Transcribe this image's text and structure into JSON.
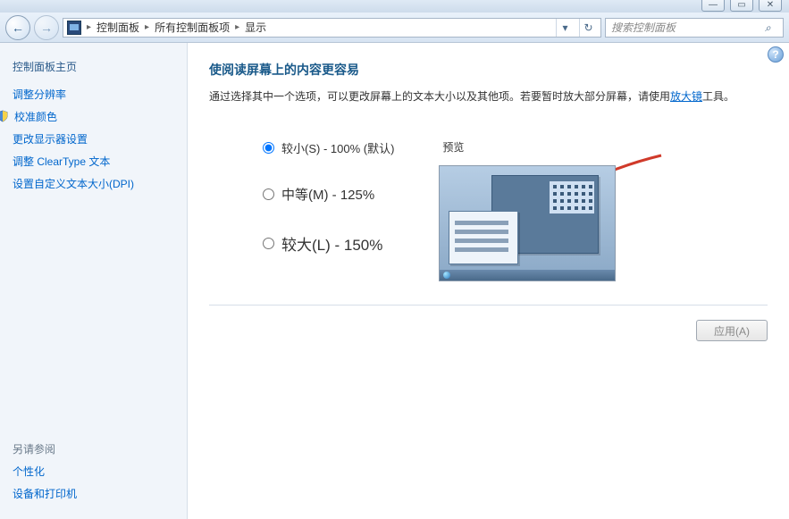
{
  "window_buttons": {
    "minimize": "—",
    "maximize": "▭",
    "close": "✕"
  },
  "nav": {
    "back_glyph": "←",
    "forward_glyph": "→",
    "dropdown_glyph": "▾",
    "refresh_glyph": "↻"
  },
  "breadcrumb": {
    "items": [
      "控制面板",
      "所有控制面板项",
      "显示"
    ],
    "sep": "▸"
  },
  "search": {
    "placeholder": "搜索控制面板",
    "icon_glyph": "⌕"
  },
  "sidebar": {
    "heading": "控制面板主页",
    "links": [
      {
        "label": "调整分辨率",
        "shield": false
      },
      {
        "label": "校准颜色",
        "shield": true
      },
      {
        "label": "更改显示器设置",
        "shield": false
      },
      {
        "label": "调整 ClearType 文本",
        "shield": false
      },
      {
        "label": "设置自定义文本大小(DPI)",
        "shield": false
      }
    ],
    "see_also_heading": "另请参阅",
    "see_also": [
      "个性化",
      "设备和打印机"
    ]
  },
  "main": {
    "help_glyph": "?",
    "title": "使阅读屏幕上的内容更容易",
    "desc_pre": "通过选择其中一个选项，可以更改屏幕上的文本大小以及其他项。若要暂时放大部分屏幕，请使用",
    "desc_link": "放大镜",
    "desc_post": "工具。",
    "options": [
      {
        "id": "small",
        "label": "较小(S) - 100% (默认)",
        "checked": true
      },
      {
        "id": "medium",
        "label": "中等(M) - 125%",
        "checked": false
      },
      {
        "id": "large",
        "label": "较大(L) - 150%",
        "checked": false
      }
    ],
    "preview_label": "预览",
    "apply_label": "应用(A)"
  }
}
